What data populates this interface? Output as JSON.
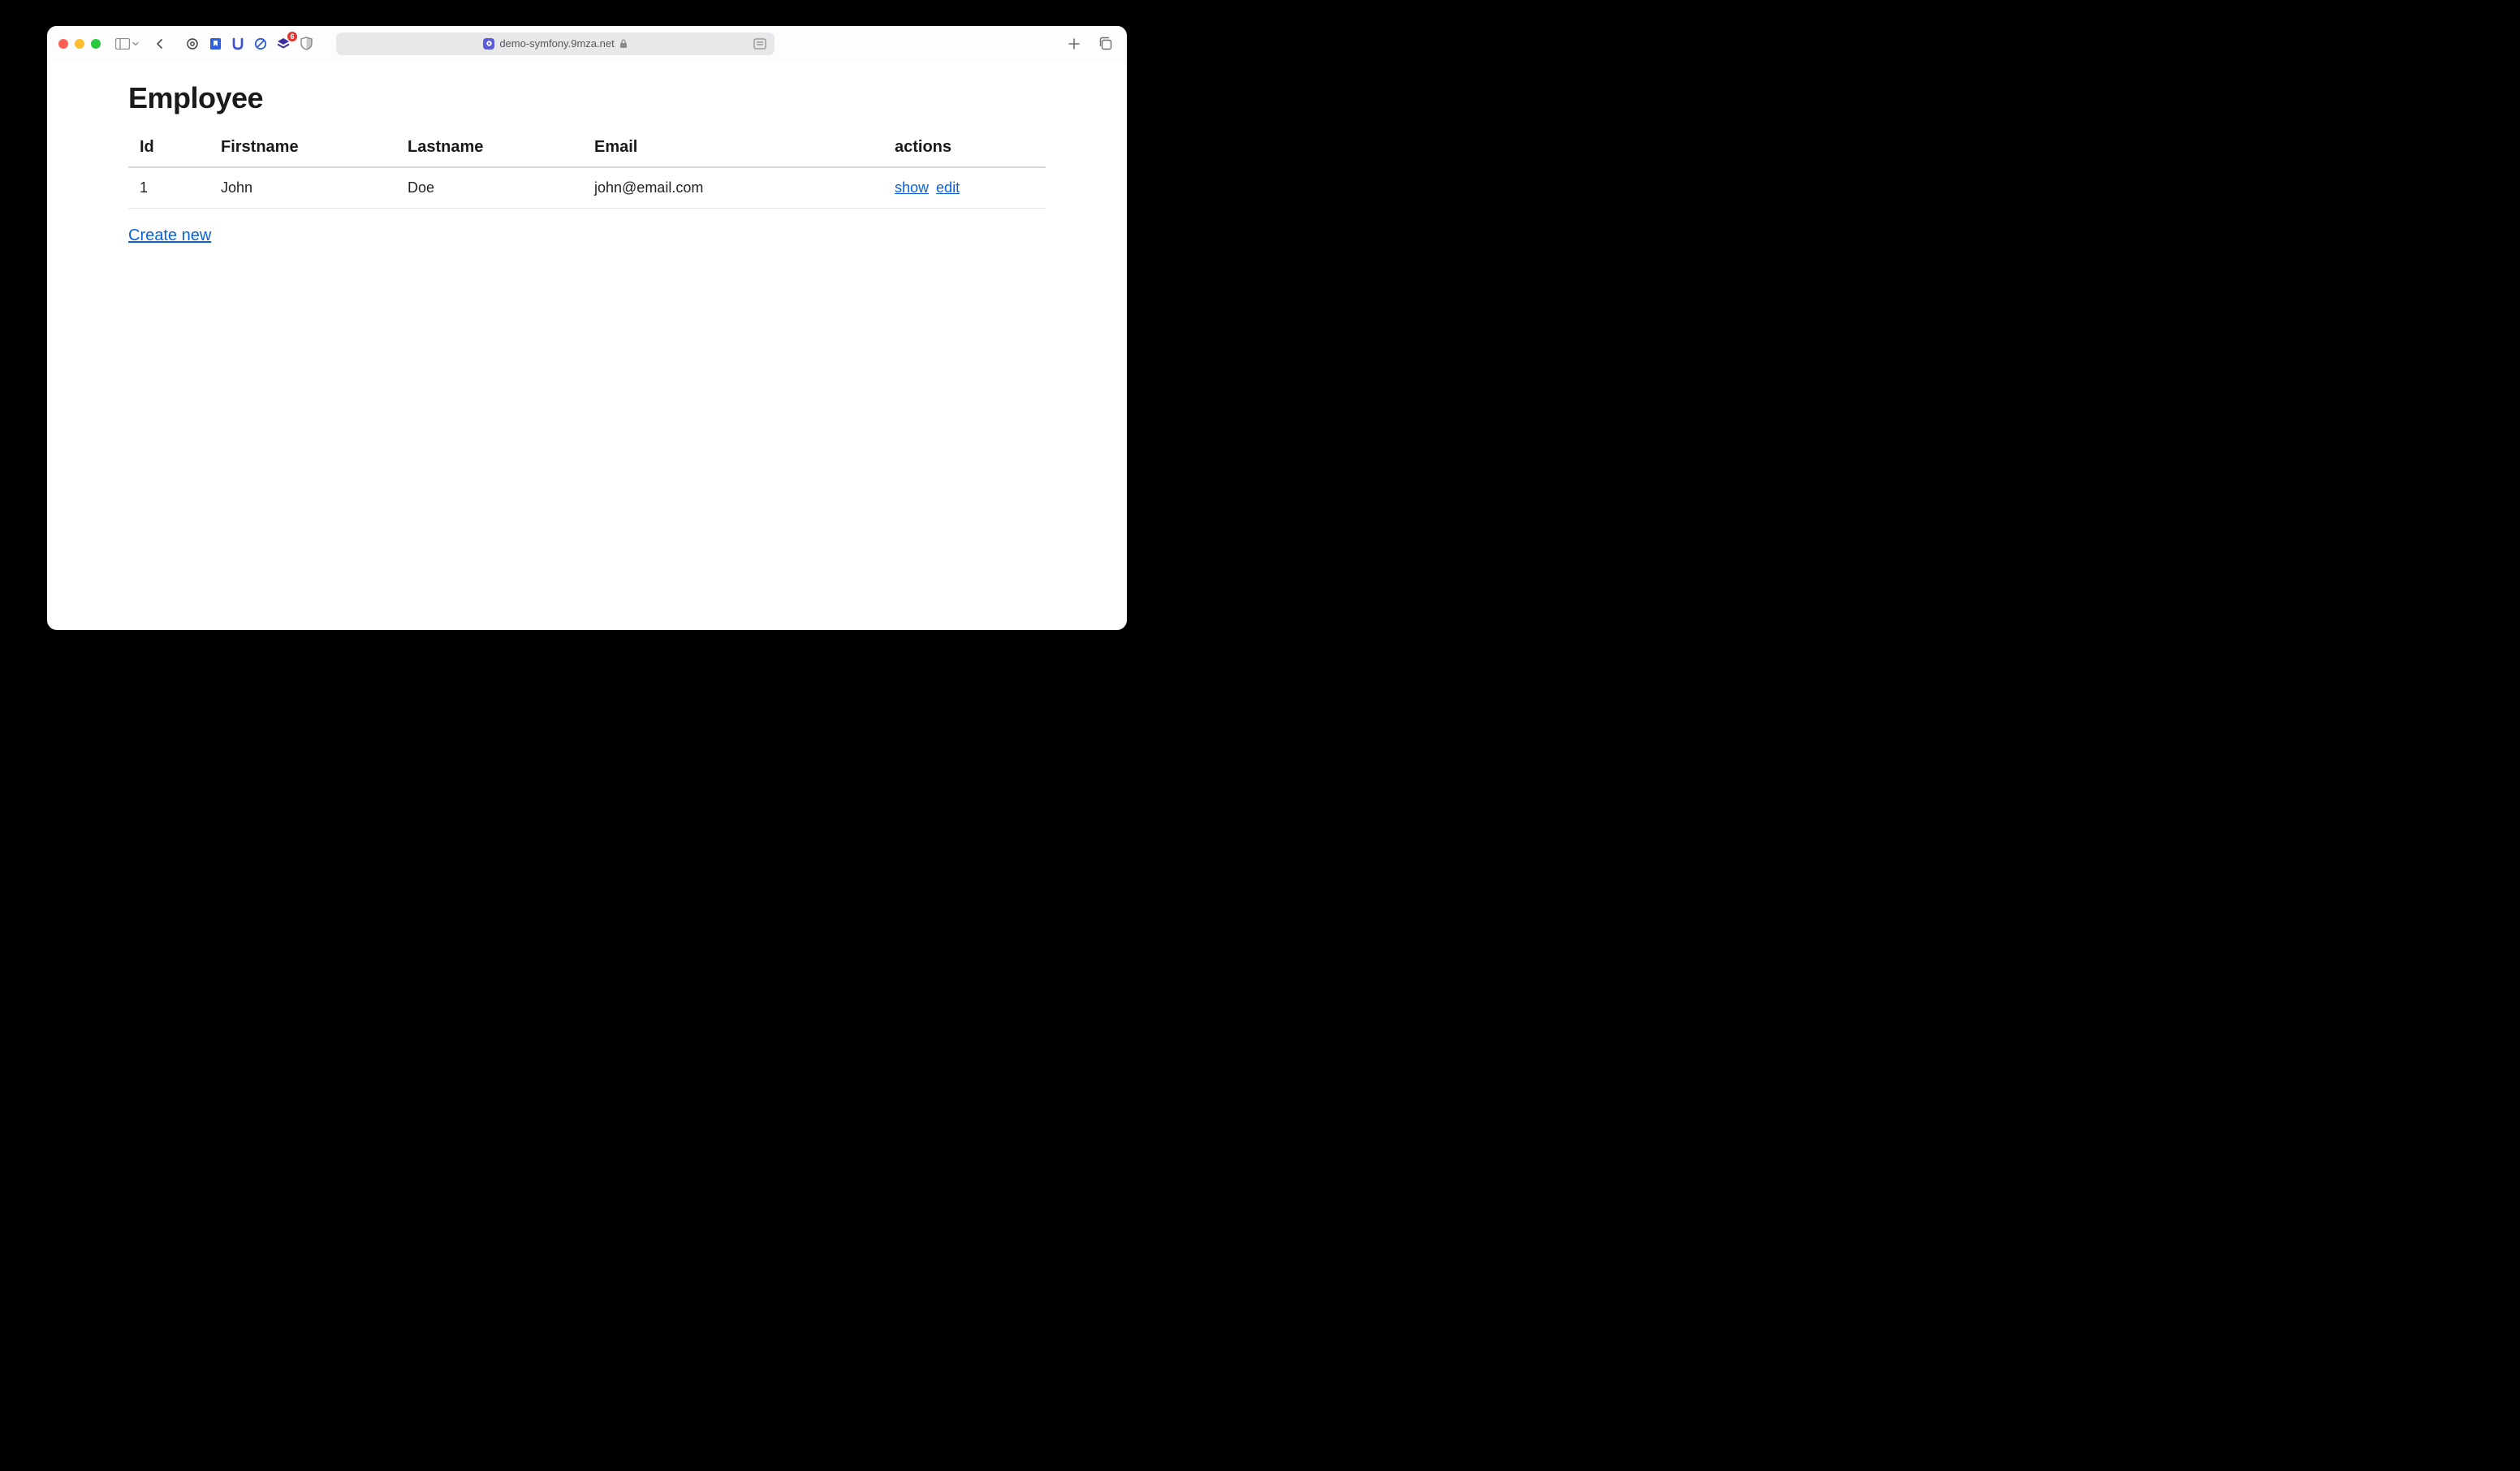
{
  "browser": {
    "url_display": "demo-symfony.9mza.net",
    "badge_count": "6"
  },
  "page": {
    "title": "Employee",
    "create_link_label": "Create new"
  },
  "table": {
    "headers": {
      "id": "Id",
      "firstname": "Firstname",
      "lastname": "Lastname",
      "email": "Email",
      "actions": "actions"
    },
    "rows": [
      {
        "id": "1",
        "firstname": "John",
        "lastname": "Doe",
        "email": "john@email.com",
        "action_show": "show",
        "action_edit": "edit"
      }
    ]
  }
}
